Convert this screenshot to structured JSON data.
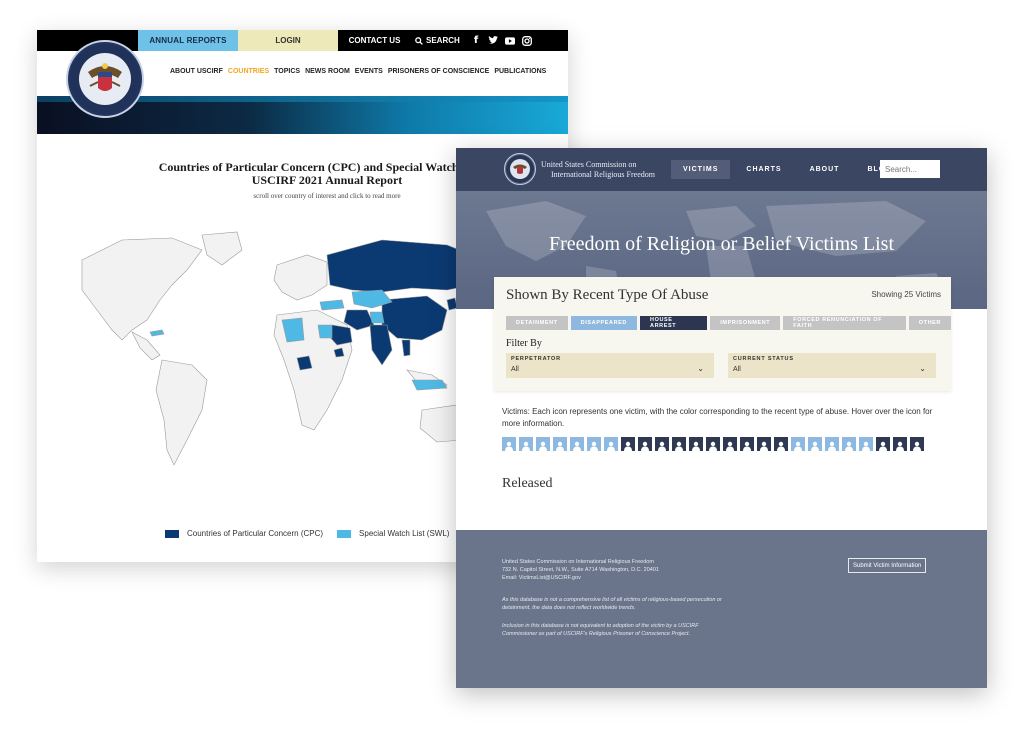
{
  "back_page": {
    "topbar": {
      "annual_reports": "ANNUAL REPORTS",
      "login": "LOGIN",
      "contact_us": "CONTACT US",
      "search": "SEARCH",
      "social_icons": [
        "facebook-icon",
        "twitter-icon",
        "youtube-icon",
        "instagram-icon"
      ]
    },
    "nav": [
      "ABOUT USCIRF",
      "COUNTRIES",
      "TOPICS",
      "NEWS ROOM",
      "EVENTS",
      "PRISONERS OF CONSCIENCE",
      "PUBLICATIONS"
    ],
    "nav_active": "COUNTRIES",
    "map": {
      "title_line1": "Countries of Particular Concern (CPC) and Special Watch List (S",
      "title_line2": "USCIRF 2021 Annual Report",
      "subtitle": "scroll over country of interest and click to read more",
      "legend": [
        {
          "label": "Countries of Particular Concern (CPC)",
          "color": "#0b3a73"
        },
        {
          "label": "Special Watch List (SWL)",
          "color": "#4fb9e6"
        }
      ]
    }
  },
  "front_page": {
    "org_line1": "United States Commission on",
    "org_line2": "International Religious Freedom",
    "nav": [
      "VICTIMS",
      "CHARTS",
      "ABOUT",
      "BLOG"
    ],
    "nav_active": "VICTIMS",
    "search_placeholder": "Search...",
    "hero_title": "Freedom of Religion or Belief Victims List",
    "card": {
      "heading": "Shown By Recent Type Of Abuse",
      "showing": "Showing 25 Victims",
      "abuse_tabs": [
        "DETAINMENT",
        "DISAPPEARED",
        "HOUSE ARREST",
        "IMPRISONMENT",
        "FORCED RENUNCIATION OF FAITH",
        "OTHER"
      ],
      "active_tab": "HOUSE ARREST",
      "filter_by": "Filter By",
      "perpetrator_label": "PERPETRATOR",
      "perpetrator_value": "All",
      "status_label": "CURRENT STATUS",
      "status_value": "All"
    },
    "victims_description": "Victims: Each icon represents one victim, with the color corresponding to the recent type of abuse. Hover over the icon for more information.",
    "victim_icons": [
      "dis",
      "dis",
      "dis",
      "dis",
      "dis",
      "dis",
      "dis",
      "house",
      "house",
      "house",
      "house",
      "house",
      "house",
      "house",
      "house",
      "house",
      "house",
      "dis",
      "dis",
      "dis",
      "dis",
      "dis",
      "house",
      "house",
      "house"
    ],
    "released_heading": "Released",
    "footer": {
      "address_line1": "United States Commission on International Religious Freedom",
      "address_line2": "732 N. Capitol Street, N.W., Suite A714 Washington, D.C. 20401",
      "address_line3": "Email: VictimsList@USCIRF.gov",
      "note1": "As this database is not a comprehensive list of all victims of religious-based persecution or detainment, the data does not reflect worldwide trends.",
      "note2": "Inclusion in this database is not equivalent to adoption of the victim by a USCIRF Commissioner as part of USCIRF's Religious Prisoner of Conscience Project.",
      "submit_button": "Submit Victim Information"
    }
  }
}
